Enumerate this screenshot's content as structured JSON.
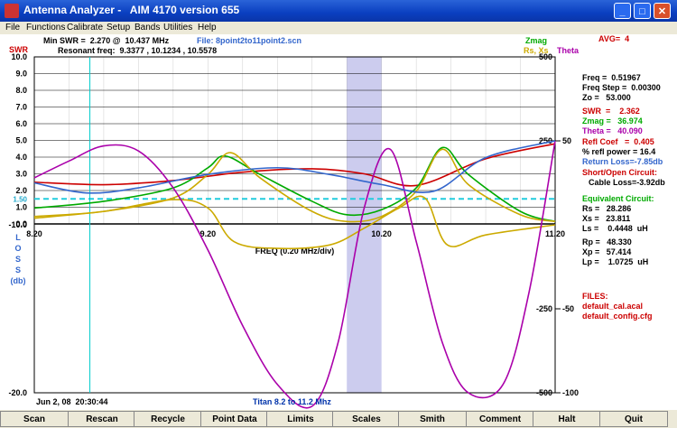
{
  "window": {
    "title": "Antenna Analyzer -   AIM 4170 version 655"
  },
  "menu": [
    "File",
    "Functions",
    "Calibrate",
    "Setup",
    "Bands",
    "Utilities",
    "Help"
  ],
  "header": {
    "swr_label": "SWR",
    "min_swr": "Min SWR =  2.270 @  10.437 MHz",
    "resonant": "Resonant freq:  9.3377 , 10.1234 , 10.5578",
    "file": "File: 8point2to11point2.scn",
    "zmag": "Zmag",
    "rsxs": "Rs, Xs",
    "theta": "Theta",
    "avg": "AVG=  4"
  },
  "axes": {
    "swr_ticks": [
      "10.0",
      "9.0",
      "8.0",
      "7.0",
      "6.0",
      "5.0",
      "4.0",
      "3.0",
      "2.0",
      "1.0",
      "0.0"
    ],
    "swr_ref": "1.50",
    "loss_label": [
      "L",
      "O",
      "S",
      "S",
      "(db)"
    ],
    "loss_ticks": [
      "-10.0",
      "-20.0"
    ],
    "freq_ticks": [
      "8.20",
      "9.20",
      "10.20",
      "11.20"
    ],
    "freq_label": "FREQ (0.20 MHz/div)",
    "z_ticks": [
      "500",
      "250",
      "-250",
      "-500"
    ],
    "theta_ticks": [
      "50",
      "-50",
      "-100"
    ]
  },
  "readout": {
    "freq": "Freq =  0.51967",
    "freq_step": "Freq Step =  0.00300",
    "zo": "Zo =   53.000",
    "swr": "SWR  =    2.362",
    "zmag": "Zmag =   36.974",
    "theta": "Theta =   40.090",
    "refl_coef": "Refl Coef   =  0.405",
    "refl_power": "% refl power = 16.4",
    "return_loss": "Return Loss=-7.85db",
    "short_open": "Short/Open Circuit:",
    "cable_loss": "Cable Loss=-3.92db",
    "equiv": "Equivalent Circuit:",
    "rs": "Rs =   28.286",
    "xs": "Xs =   23.811",
    "ls": "Ls =    0.4448  uH",
    "rp": "Rp =   48.330",
    "xp": "Xp =   57.414",
    "lp": "Lp =    1.0725  uH",
    "files_label": "FILES:",
    "file1": "default_cal.acal",
    "file2": "default_config.cfg"
  },
  "footer": {
    "date": "Jun 2, 08  20:30:44",
    "caption": "Titan 8.2 to 11.2 Mhz"
  },
  "buttons": [
    "Scan",
    "Rescan",
    "Recycle",
    "Point Data",
    "Limits",
    "Scales",
    "Smith",
    "Comment",
    "Halt",
    "Quit"
  ],
  "colors": {
    "swr": "#cc0000",
    "zmag": "#00aa00",
    "rsxs": "#ccaa00",
    "theta": "#aa00aa",
    "loss": "#3366cc",
    "cursor": "#00cccc",
    "band": "#ccccee"
  },
  "chart_data": {
    "type": "line",
    "x_range": [
      8.2,
      11.2
    ],
    "swr_range": [
      0,
      10
    ],
    "loss_range": [
      -20,
      0
    ],
    "z_range": [
      -500,
      500
    ],
    "theta_range": [
      -100,
      100
    ],
    "cursor_freq": 8.52,
    "band": [
      10.0,
      10.2
    ],
    "swr_ref_value": 1.5,
    "series": [
      {
        "name": "SWR",
        "key": "swr",
        "x": [
          8.2,
          8.6,
          9.0,
          9.4,
          9.8,
          10.1,
          10.4,
          10.8,
          11.2
        ],
        "y": [
          2.5,
          2.35,
          2.6,
          3.1,
          3.3,
          3.0,
          2.3,
          3.9,
          4.8
        ]
      },
      {
        "name": "Zmag",
        "key": "zmag",
        "x": [
          8.2,
          8.6,
          9.0,
          9.2,
          9.3,
          9.5,
          9.8,
          10.0,
          10.2,
          10.4,
          10.55,
          10.7,
          11.0,
          11.2
        ],
        "y": [
          50,
          70,
          110,
          170,
          205,
          150,
          70,
          30,
          45,
          110,
          230,
          150,
          40,
          10
        ]
      },
      {
        "name": "Rs",
        "key": "rsxs",
        "x": [
          8.2,
          8.6,
          9.0,
          9.2,
          9.33,
          9.5,
          9.8,
          10.0,
          10.2,
          10.4,
          10.55,
          10.7,
          11.0,
          11.2
        ],
        "y": [
          25,
          40,
          80,
          150,
          215,
          140,
          40,
          10,
          25,
          100,
          225,
          120,
          30,
          10
        ]
      },
      {
        "name": "Xs",
        "key": "rsxs",
        "x": [
          8.2,
          8.6,
          9.0,
          9.2,
          9.35,
          9.6,
          9.9,
          10.1,
          10.3,
          10.45,
          10.58,
          10.8,
          11.2
        ],
        "y": [
          20,
          40,
          75,
          50,
          -50,
          -70,
          -60,
          -10,
          50,
          80,
          -60,
          -30,
          0
        ]
      },
      {
        "name": "Theta",
        "key": "theta",
        "x": [
          8.2,
          8.4,
          8.6,
          8.8,
          9.0,
          9.2,
          9.4,
          9.6,
          9.8,
          9.95,
          10.1,
          10.25,
          10.4,
          10.55,
          10.7,
          10.9,
          11.05,
          11.2
        ],
        "y": [
          28,
          38,
          47,
          44,
          22,
          -15,
          -60,
          -95,
          -108,
          -70,
          10,
          45,
          -10,
          -70,
          -100,
          -95,
          -40,
          50
        ]
      },
      {
        "name": "Return Loss",
        "key": "loss",
        "x": [
          8.2,
          8.5,
          8.8,
          9.2,
          9.6,
          9.9,
          10.2,
          10.5,
          10.8,
          11.2
        ],
        "y": [
          -7.5,
          -8.1,
          -7.8,
          -7.0,
          -6.6,
          -7.0,
          -7.6,
          -8.0,
          -6.0,
          -5.0
        ]
      }
    ]
  }
}
